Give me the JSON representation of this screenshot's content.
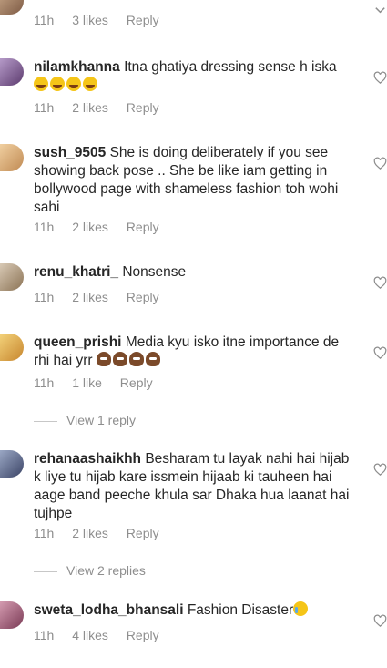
{
  "comments": [
    {
      "id": 0,
      "username": "",
      "text": "",
      "time": "11h",
      "likes": "3 likes",
      "reply": "Reply"
    },
    {
      "id": 1,
      "username": "nilamkhanna",
      "text": "Itna ghatiya dressing sense h iska",
      "time": "11h",
      "likes": "2 likes",
      "reply": "Reply",
      "emoji": "laughing-emoji"
    },
    {
      "id": 2,
      "username": "sush_9505",
      "text": "She is doing deliberately if you see showing back pose .. She be like iam getting in bollywood page with shameless fashion toh wohi sahi",
      "time": "11h",
      "likes": "2 likes",
      "reply": "Reply"
    },
    {
      "id": 3,
      "username": "renu_khatri_",
      "text": "Nonsense",
      "time": "11h",
      "likes": "2 likes",
      "reply": "Reply"
    },
    {
      "id": 4,
      "username": "queen_prishi",
      "text": "Media kyu isko itne importance de rhi hai yrr",
      "time": "11h",
      "likes": "1 like",
      "reply": "Reply",
      "emoji": "pile-of-poo-emoji",
      "view_replies": "View 1 reply"
    },
    {
      "id": 5,
      "username": "rehanaashaikhh",
      "text": "Besharam tu layak nahi hai hijab k liye tu hijab kare issmein hijaab ki tauheen hai aage band peeche khula sar Dhaka hua laanat hai tujhpe",
      "time": "11h",
      "likes": "2 likes",
      "reply": "Reply",
      "view_replies": "View 2 replies"
    },
    {
      "id": 6,
      "username": "sweta_lodha_bhansali",
      "text": "Fashion Disaster",
      "time": "11h",
      "likes": "4 likes",
      "reply": "Reply",
      "emoji": "crying-face-emoji"
    }
  ],
  "icons": {
    "heart": "heart-outline-icon",
    "chevron": "chevron-down-icon"
  },
  "colors": {
    "text": "#262626",
    "meta": "#8e8e8e",
    "icon": "#8e8e8e"
  }
}
